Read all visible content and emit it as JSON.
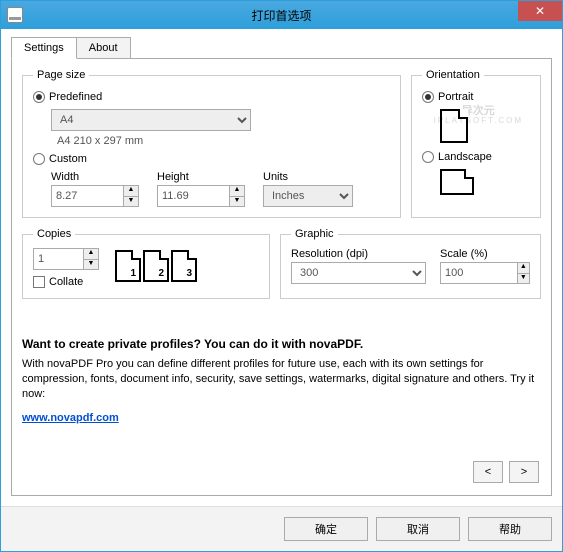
{
  "window": {
    "title": "打印首选项"
  },
  "tabs": {
    "settings": "Settings",
    "about": "About"
  },
  "pagesize": {
    "legend": "Page size",
    "predefined_label": "Predefined",
    "predefined_value": "A4",
    "dims": "A4 210 x 297 mm",
    "custom_label": "Custom",
    "width_label": "Width",
    "width_value": "8.27",
    "height_label": "Height",
    "height_value": "11.69",
    "units_label": "Units",
    "units_value": "Inches"
  },
  "orientation": {
    "legend": "Orientation",
    "portrait_label": "Portrait",
    "landscape_label": "Landscape"
  },
  "copies": {
    "legend": "Copies",
    "value": "1",
    "collate_label": "Collate"
  },
  "graphic": {
    "legend": "Graphic",
    "resolution_label": "Resolution (dpi)",
    "resolution_value": "300",
    "scale_label": "Scale (%)",
    "scale_value": "100"
  },
  "promo": {
    "title": "Want to create private profiles? You can do it with novaPDF.",
    "text": "With novaPDF Pro you can define different profiles for future use, each with its own settings for compression, fonts, document info, security, save settings, watermarks, digital signature and others. Try it now:",
    "link_text": "www.novapdf.com"
  },
  "nav": {
    "prev": "<",
    "next": ">"
  },
  "footer": {
    "ok": "确定",
    "cancel": "取消",
    "help": "帮助"
  },
  "watermark": {
    "main": "异次元",
    "sub": "IPLAYSOFT.COM"
  }
}
